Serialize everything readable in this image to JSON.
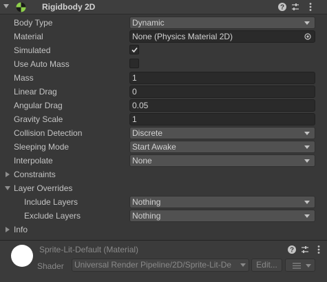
{
  "component": {
    "title": "Rigidbody 2D",
    "icon": "rigidbody2d-icon"
  },
  "header_buttons": [
    "help-icon",
    "presets-icon",
    "more-icon"
  ],
  "properties": {
    "body_type": {
      "label": "Body Type",
      "value": "Dynamic"
    },
    "material": {
      "label": "Material",
      "value": "None (Physics Material 2D)"
    },
    "simulated": {
      "label": "Simulated",
      "checked": true
    },
    "use_auto_mass": {
      "label": "Use Auto Mass",
      "checked": false
    },
    "mass": {
      "label": "Mass",
      "value": "1"
    },
    "linear_drag": {
      "label": "Linear Drag",
      "value": "0"
    },
    "angular_drag": {
      "label": "Angular Drag",
      "value": "0.05"
    },
    "gravity_scale": {
      "label": "Gravity Scale",
      "value": "1"
    },
    "collision_detection": {
      "label": "Collision Detection",
      "value": "Discrete"
    },
    "sleeping_mode": {
      "label": "Sleeping Mode",
      "value": "Start Awake"
    },
    "interpolate": {
      "label": "Interpolate",
      "value": "None"
    }
  },
  "foldouts": {
    "constraints": {
      "label": "Constraints",
      "expanded": false
    },
    "layer_overrides": {
      "label": "Layer Overrides",
      "expanded": true
    },
    "info": {
      "label": "Info",
      "expanded": false
    }
  },
  "layer_overrides": {
    "include_layers": {
      "label": "Include Layers",
      "value": "Nothing"
    },
    "exclude_layers": {
      "label": "Exclude Layers",
      "value": "Nothing"
    }
  },
  "material_section": {
    "name": "Sprite-Lit-Default (Material)",
    "shader_label": "Shader",
    "shader_value": "Universal Render Pipeline/2D/Sprite-Lit-De",
    "edit_label": "Edit..."
  },
  "colors": {
    "background": "#383838",
    "header": "#3e3e3e",
    "field": "#2a2a2a",
    "dropdown": "#515151",
    "text": "#c4c4c4",
    "icon_green": "#8ed04b"
  }
}
